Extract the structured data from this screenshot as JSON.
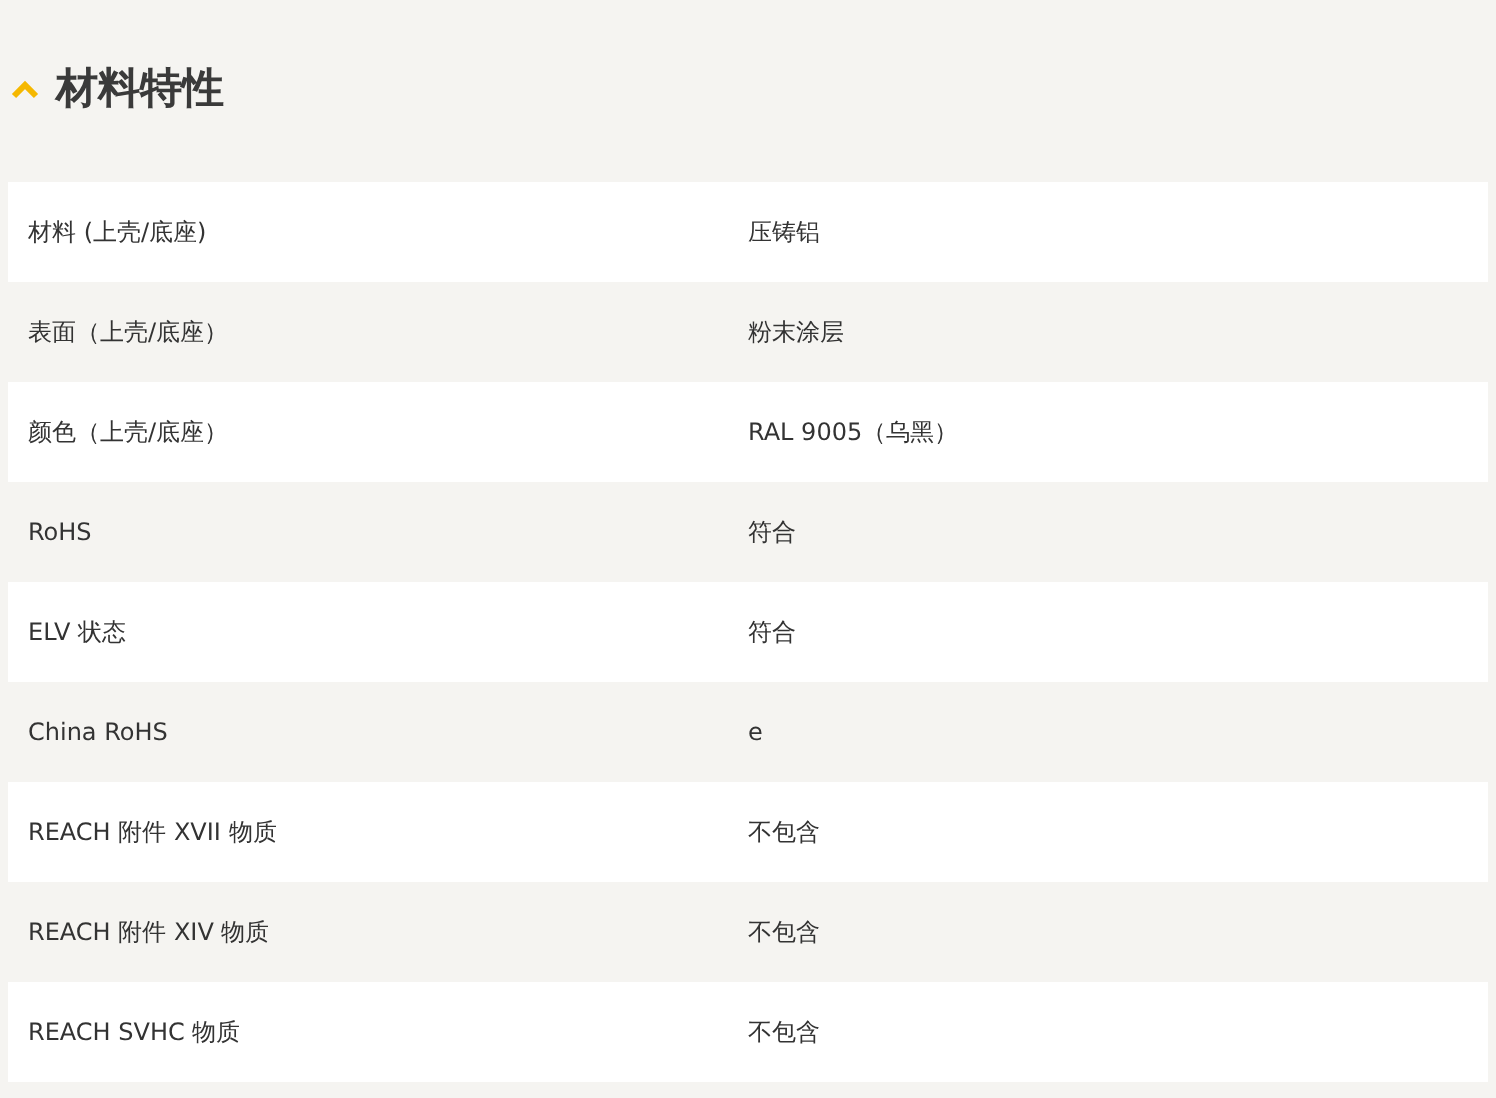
{
  "section": {
    "title": "材料特性",
    "expanded": true
  },
  "rows": [
    {
      "label": "材料 (上壳/底座)",
      "value": "压铸铝"
    },
    {
      "label": "表面（上壳/底座）",
      "value": "粉末涂层"
    },
    {
      "label": "颜色（上壳/底座）",
      "value": "RAL 9005（乌黑）"
    },
    {
      "label": "RoHS",
      "value": "符合"
    },
    {
      "label": "ELV 状态",
      "value": "符合"
    },
    {
      "label": "China RoHS",
      "value": "e"
    },
    {
      "label": "REACH 附件 XVII 物质",
      "value": "不包含"
    },
    {
      "label": "REACH 附件 XIV 物质",
      "value": "不包含"
    },
    {
      "label": "REACH SVHC 物质",
      "value": "不包含"
    }
  ]
}
